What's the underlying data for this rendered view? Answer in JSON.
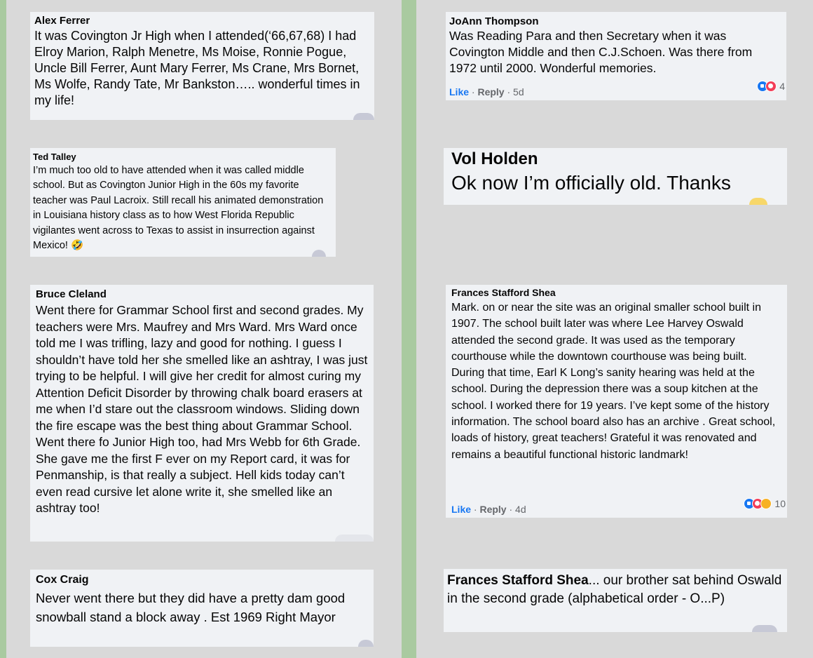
{
  "colors": {
    "background": "#d9d9d9",
    "divider_green": "#a9caa0",
    "bubble": "#f0f2f5",
    "link_blue": "#1877f2",
    "meta_gray": "#65676b"
  },
  "left_column": [
    {
      "name": "Alex Ferrer",
      "text": "It was Covington Jr High when I attended(‘66,67,68) I had Elroy Marion, Ralph Menetre, Ms Moise, Ronnie Pogue, Uncle Bill Ferrer, Aunt Mary Ferrer, Ms Crane, Mrs Bornet, Ms Wolfe, Randy Tate, Mr Bankston….. wonderful times in my life!"
    },
    {
      "name": "Ted Talley",
      "text": "I’m much too old to have attended when it was called middle school. But as Covington Junior High in the 60s my favorite teacher was Paul Lacroix. Still recall his animated demonstration in Louisiana history class as to how West Florida Republic vigilantes went across to Texas to assist in insurrection against Mexico! 🤣"
    },
    {
      "name": "Bruce Cleland",
      "text": "Went there for Grammar School first and second grades. My teachers were Mrs. Maufrey and Mrs Ward. Mrs Ward once told me I was trifling, lazy and good for nothing. I guess I shouldn’t have told her she smelled like an ashtray, I was just trying to be helpful. I will give her credit for almost curing my Attention Deficit Disorder by throwing chalk board erasers at me when I’d stare out the classroom windows. Sliding down the fire escape was the best thing about Grammar School. Went there fo Junior High too, had Mrs Webb for 6th Grade. She gave me the first F ever on my Report card, it was for Penmanship, is that really a subject. Hell kids today can’t even read cursive let alone write it, she smelled like an ashtray too!"
    },
    {
      "name": "Cox Craig",
      "text": "Never went there but they did have a pretty dam good snowball stand a block away . Est 1969 Right Mayor"
    }
  ],
  "right_column": [
    {
      "name": "JoAnn Thompson",
      "text": "Was Reading Para and then Secretary when it was Covington Middle and then C.J.Schoen. Was there from 1972 until 2000. Wonderful memories.",
      "like": "Like",
      "sep": "·",
      "reply": "Reply",
      "time": "5d",
      "reactions": {
        "icons": [
          "like-icon",
          "love-icon"
        ],
        "count": "4"
      }
    },
    {
      "name": "Vol Holden",
      "text": "Ok now I’m officially old. Thanks"
    },
    {
      "name": "Frances Stafford Shea",
      "text": "Mark. on or near the site was an original smaller school built in 1907. The school built later was where Lee Harvey Oswald attended the second grade. It was used as the temporary courthouse while the downtown courthouse was being built. During that time, Earl K Long’s sanity hearing was held at the school. During the depression there was a soup kitchen at the school. I worked there for 19 years. I’ve kept some of the history information. The school board also has an archive . Great school, loads of history, great teachers! Grateful it was renovated and remains a beautiful functional historic landmark!",
      "like": "Like",
      "sep": "·",
      "reply": "Reply",
      "time": "4d",
      "reactions": {
        "icons": [
          "like-icon",
          "love-icon",
          "care-icon"
        ],
        "count": "10"
      }
    },
    {
      "name": "Frances Stafford Shea",
      "text": "... our brother sat behind Oswald in the second grade (alphabetical order - O...P)"
    }
  ]
}
